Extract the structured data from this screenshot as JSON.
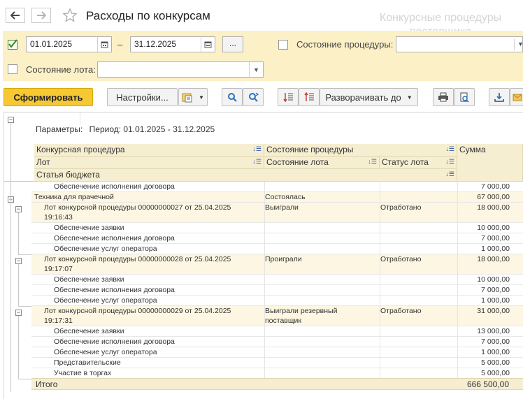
{
  "window": {
    "title": "Расходы по конкурсам",
    "watermark": "Конкурсные процедуры поставщика",
    "back_icon": "arrow-left-icon",
    "forward_icon": "arrow-right-icon",
    "favorite_icon": "star-icon"
  },
  "filters": {
    "period_enabled": true,
    "date_from": "01.01.2025",
    "dash": "–",
    "date_to": "31.12.2025",
    "more_label": "...",
    "procedure_state_label": "Состояние процедуры:",
    "procedure_state_value": "",
    "lot_state_label": "Состояние лота:",
    "lot_state_value": ""
  },
  "toolbar": {
    "generate_label": "Сформировать",
    "settings_label": "Настройки...",
    "expand_label": "Разворачивать до"
  },
  "report": {
    "params_label": "Параметры:",
    "params_value": "Период: 01.01.2025 - 31.12.2025",
    "columns": {
      "procedure": "Конкурсная процедура",
      "procedure_state": "Состояние процедуры",
      "sum": "Сумма",
      "lot": "Лот",
      "lot_state": "Состояние лота",
      "lot_status": "Статус лота",
      "budget_item": "Статья бюджета"
    },
    "rows": [
      {
        "level": 2,
        "text": "Обеспечение исполнения договора",
        "state": "",
        "status": "",
        "sum": "7 000,00"
      },
      {
        "level": 0,
        "text": "Техника для прачечной",
        "state": "Состоялась",
        "status": "",
        "sum": "67 000,00",
        "group": true
      },
      {
        "level": 1,
        "text": "Лот конкурсной процедуры 00000000027 от 25.04.2025",
        "text2": "19:16:43",
        "state": "Выиграли",
        "status": "Отработано",
        "sum": "18 000,00",
        "group": true
      },
      {
        "level": 2,
        "text": "Обеспечение заявки",
        "state": "",
        "status": "",
        "sum": "10 000,00"
      },
      {
        "level": 2,
        "text": "Обеспечение исполнения договора",
        "state": "",
        "status": "",
        "sum": "7 000,00"
      },
      {
        "level": 2,
        "text": "Обеспечение услуг оператора",
        "state": "",
        "status": "",
        "sum": "1 000,00"
      },
      {
        "level": 1,
        "text": "Лот конкурсной процедуры 00000000028 от 25.04.2025",
        "text2": "19:17:07",
        "state": "Проиграли",
        "status": "Отработано",
        "sum": "18 000,00",
        "group": true
      },
      {
        "level": 2,
        "text": "Обеспечение заявки",
        "state": "",
        "status": "",
        "sum": "10 000,00"
      },
      {
        "level": 2,
        "text": "Обеспечение исполнения договора",
        "state": "",
        "status": "",
        "sum": "7 000,00"
      },
      {
        "level": 2,
        "text": "Обеспечение услуг оператора",
        "state": "",
        "status": "",
        "sum": "1 000,00"
      },
      {
        "level": 1,
        "text": "Лот конкурсной процедуры 00000000029 от 25.04.2025",
        "text2": "19:17:31",
        "state": "Выиграли резервный",
        "state2": "поставщик",
        "status": "Отработано",
        "sum": "31 000,00",
        "group": true
      },
      {
        "level": 2,
        "text": "Обеспечение заявки",
        "state": "",
        "status": "",
        "sum": "13 000,00"
      },
      {
        "level": 2,
        "text": "Обеспечение исполнения договора",
        "state": "",
        "status": "",
        "sum": "7 000,00"
      },
      {
        "level": 2,
        "text": "Обеспечение услуг оператора",
        "state": "",
        "status": "",
        "sum": "1 000,00"
      },
      {
        "level": 2,
        "text": "Представительские",
        "state": "",
        "status": "",
        "sum": "5 000,00"
      },
      {
        "level": 2,
        "text": "Участие в торгах",
        "state": "",
        "status": "",
        "sum": "5 000,00"
      }
    ],
    "total_label": "Итого",
    "total_value": "666 500,00"
  }
}
